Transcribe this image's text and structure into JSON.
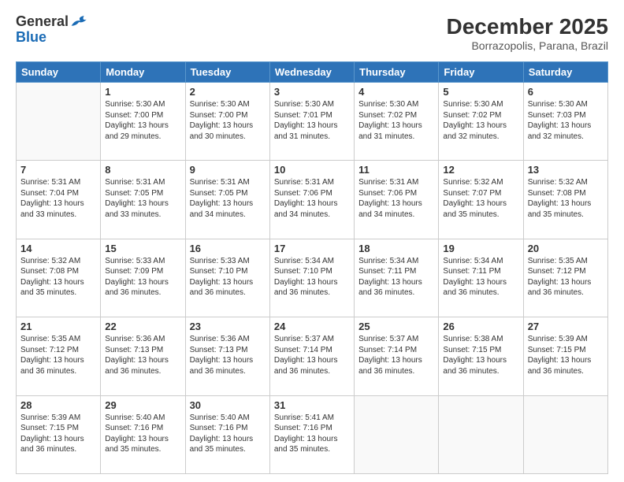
{
  "header": {
    "logo": {
      "line1": "General",
      "line2": "Blue"
    },
    "title": "December 2025",
    "subtitle": "Borrazopolis, Parana, Brazil"
  },
  "weekdays": [
    "Sunday",
    "Monday",
    "Tuesday",
    "Wednesday",
    "Thursday",
    "Friday",
    "Saturday"
  ],
  "weeks": [
    [
      {
        "day": "",
        "info": ""
      },
      {
        "day": "1",
        "info": "Sunrise: 5:30 AM\nSunset: 7:00 PM\nDaylight: 13 hours\nand 29 minutes."
      },
      {
        "day": "2",
        "info": "Sunrise: 5:30 AM\nSunset: 7:00 PM\nDaylight: 13 hours\nand 30 minutes."
      },
      {
        "day": "3",
        "info": "Sunrise: 5:30 AM\nSunset: 7:01 PM\nDaylight: 13 hours\nand 31 minutes."
      },
      {
        "day": "4",
        "info": "Sunrise: 5:30 AM\nSunset: 7:02 PM\nDaylight: 13 hours\nand 31 minutes."
      },
      {
        "day": "5",
        "info": "Sunrise: 5:30 AM\nSunset: 7:02 PM\nDaylight: 13 hours\nand 32 minutes."
      },
      {
        "day": "6",
        "info": "Sunrise: 5:30 AM\nSunset: 7:03 PM\nDaylight: 13 hours\nand 32 minutes."
      }
    ],
    [
      {
        "day": "7",
        "info": "Sunrise: 5:31 AM\nSunset: 7:04 PM\nDaylight: 13 hours\nand 33 minutes."
      },
      {
        "day": "8",
        "info": "Sunrise: 5:31 AM\nSunset: 7:05 PM\nDaylight: 13 hours\nand 33 minutes."
      },
      {
        "day": "9",
        "info": "Sunrise: 5:31 AM\nSunset: 7:05 PM\nDaylight: 13 hours\nand 34 minutes."
      },
      {
        "day": "10",
        "info": "Sunrise: 5:31 AM\nSunset: 7:06 PM\nDaylight: 13 hours\nand 34 minutes."
      },
      {
        "day": "11",
        "info": "Sunrise: 5:31 AM\nSunset: 7:06 PM\nDaylight: 13 hours\nand 34 minutes."
      },
      {
        "day": "12",
        "info": "Sunrise: 5:32 AM\nSunset: 7:07 PM\nDaylight: 13 hours\nand 35 minutes."
      },
      {
        "day": "13",
        "info": "Sunrise: 5:32 AM\nSunset: 7:08 PM\nDaylight: 13 hours\nand 35 minutes."
      }
    ],
    [
      {
        "day": "14",
        "info": "Sunrise: 5:32 AM\nSunset: 7:08 PM\nDaylight: 13 hours\nand 35 minutes."
      },
      {
        "day": "15",
        "info": "Sunrise: 5:33 AM\nSunset: 7:09 PM\nDaylight: 13 hours\nand 36 minutes."
      },
      {
        "day": "16",
        "info": "Sunrise: 5:33 AM\nSunset: 7:10 PM\nDaylight: 13 hours\nand 36 minutes."
      },
      {
        "day": "17",
        "info": "Sunrise: 5:34 AM\nSunset: 7:10 PM\nDaylight: 13 hours\nand 36 minutes."
      },
      {
        "day": "18",
        "info": "Sunrise: 5:34 AM\nSunset: 7:11 PM\nDaylight: 13 hours\nand 36 minutes."
      },
      {
        "day": "19",
        "info": "Sunrise: 5:34 AM\nSunset: 7:11 PM\nDaylight: 13 hours\nand 36 minutes."
      },
      {
        "day": "20",
        "info": "Sunrise: 5:35 AM\nSunset: 7:12 PM\nDaylight: 13 hours\nand 36 minutes."
      }
    ],
    [
      {
        "day": "21",
        "info": "Sunrise: 5:35 AM\nSunset: 7:12 PM\nDaylight: 13 hours\nand 36 minutes."
      },
      {
        "day": "22",
        "info": "Sunrise: 5:36 AM\nSunset: 7:13 PM\nDaylight: 13 hours\nand 36 minutes."
      },
      {
        "day": "23",
        "info": "Sunrise: 5:36 AM\nSunset: 7:13 PM\nDaylight: 13 hours\nand 36 minutes."
      },
      {
        "day": "24",
        "info": "Sunrise: 5:37 AM\nSunset: 7:14 PM\nDaylight: 13 hours\nand 36 minutes."
      },
      {
        "day": "25",
        "info": "Sunrise: 5:37 AM\nSunset: 7:14 PM\nDaylight: 13 hours\nand 36 minutes."
      },
      {
        "day": "26",
        "info": "Sunrise: 5:38 AM\nSunset: 7:15 PM\nDaylight: 13 hours\nand 36 minutes."
      },
      {
        "day": "27",
        "info": "Sunrise: 5:39 AM\nSunset: 7:15 PM\nDaylight: 13 hours\nand 36 minutes."
      }
    ],
    [
      {
        "day": "28",
        "info": "Sunrise: 5:39 AM\nSunset: 7:15 PM\nDaylight: 13 hours\nand 36 minutes."
      },
      {
        "day": "29",
        "info": "Sunrise: 5:40 AM\nSunset: 7:16 PM\nDaylight: 13 hours\nand 35 minutes."
      },
      {
        "day": "30",
        "info": "Sunrise: 5:40 AM\nSunset: 7:16 PM\nDaylight: 13 hours\nand 35 minutes."
      },
      {
        "day": "31",
        "info": "Sunrise: 5:41 AM\nSunset: 7:16 PM\nDaylight: 13 hours\nand 35 minutes."
      },
      {
        "day": "",
        "info": ""
      },
      {
        "day": "",
        "info": ""
      },
      {
        "day": "",
        "info": ""
      }
    ]
  ]
}
